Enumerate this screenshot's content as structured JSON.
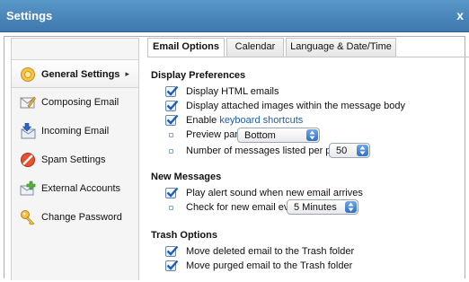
{
  "window": {
    "title": "Settings",
    "close_glyph": "x"
  },
  "sidebar": {
    "items": [
      {
        "label": "General Settings",
        "icon": "general-settings-icon",
        "active": true
      },
      {
        "label": "Composing Email",
        "icon": "compose-icon",
        "active": false
      },
      {
        "label": "Incoming Email",
        "icon": "incoming-email-icon",
        "active": false
      },
      {
        "label": "Spam Settings",
        "icon": "spam-icon",
        "active": false
      },
      {
        "label": "External Accounts",
        "icon": "external-accounts-icon",
        "active": false
      },
      {
        "label": "Change Password",
        "icon": "key-icon",
        "active": false
      }
    ],
    "active_arrow": "▸"
  },
  "tabs": [
    {
      "label": "Email Options",
      "active": true
    },
    {
      "label": "Calendar",
      "active": false
    },
    {
      "label": "Language & Date/Time",
      "active": false
    }
  ],
  "sections": {
    "display": {
      "title": "Display Preferences",
      "display_html": {
        "label": "Display HTML emails",
        "checked": true
      },
      "display_images": {
        "label": "Display attached images within the message body",
        "checked": true
      },
      "keyboard": {
        "prefix": "Enable ",
        "link": "keyboard shortcuts",
        "checked": true
      },
      "preview_pane": {
        "label": "Preview pane:",
        "value": "Bottom"
      },
      "messages_per_page": {
        "label": "Number of messages listed per page:",
        "value": "50"
      }
    },
    "new_messages": {
      "title": "New Messages",
      "alert_sound": {
        "label": "Play alert sound when new email arrives",
        "checked": true
      },
      "check_every": {
        "label": "Check for new email every:",
        "value": "5 Minutes"
      }
    },
    "trash": {
      "title": "Trash Options",
      "move_deleted": {
        "label": "Move deleted email to the Trash folder",
        "checked": true
      },
      "move_purged": {
        "label": "Move purged email to the Trash folder",
        "checked": true
      }
    }
  },
  "colors": {
    "titlebar": "#4a86bb",
    "link": "#1f5ea8",
    "checkmark": "#1d5fb3",
    "select_arrow": "#3a7bd0"
  }
}
